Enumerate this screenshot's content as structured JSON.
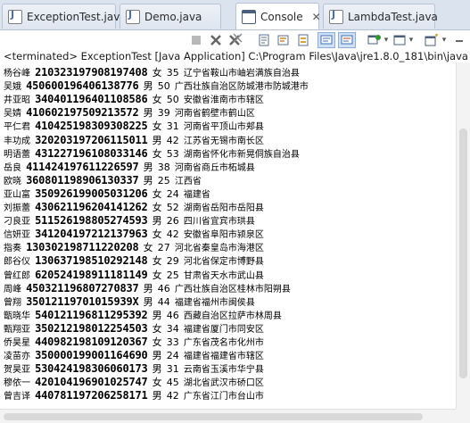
{
  "tabs": [
    {
      "label": "ExceptionTest.java",
      "icon": "java-file-icon",
      "active": false
    },
    {
      "label": "Demo.java",
      "icon": "java-file-icon",
      "active": false
    },
    {
      "label": "Console",
      "icon": "console-icon",
      "active": true,
      "close": "✕"
    },
    {
      "label": "LambdaTest.java",
      "icon": "java-file-icon",
      "active": false
    }
  ],
  "toolbar": {
    "icons": [
      "terminate-icon",
      "remove-launch-icon",
      "remove-all-terminated-icon",
      "scroll-lock-icon",
      "word-wrap-icon",
      "show-console-output-icon",
      "show-error-output-icon",
      "pin-console-icon",
      "display-selected-console-icon",
      "open-console-icon"
    ]
  },
  "status": {
    "text": "<terminated> ExceptionTest [Java Application] C:\\Program Files\\Java\\jre1.8.0_181\\bin\\javaw.exe"
  },
  "console": {
    "lines": [
      {
        "name": "杨谷峰",
        "id": "210323197908197408",
        "sex": "女",
        "age": "35",
        "place": "辽宁省鞍山市岫岩满族自治县"
      },
      {
        "name": "吴娥",
        "id": "450600196406138776",
        "sex": "男",
        "age": "50",
        "place": "广西壮族自治区防城港市防城港市"
      },
      {
        "name": "井亚昭",
        "id": "340401196401108586",
        "sex": "女",
        "age": "50",
        "place": "安徽省淮南市市辖区"
      },
      {
        "name": "吴婧",
        "id": "410602197509213572",
        "sex": "男",
        "age": "39",
        "place": "河南省鹤壁市鹤山区"
      },
      {
        "name": "平仁君",
        "id": "410425198309308225",
        "sex": "女",
        "age": "31",
        "place": "河南省平顶山市郏县"
      },
      {
        "name": "丰功成",
        "id": "320203197206115011",
        "sex": "男",
        "age": "42",
        "place": "江苏省无锡市南长区"
      },
      {
        "name": "明语蕾",
        "id": "431227196108033146",
        "sex": "女",
        "age": "53",
        "place": "湖南省怀化市新晃侗族自治县"
      },
      {
        "name": "岳良",
        "id": "411424197611226597",
        "sex": "男",
        "age": "38",
        "place": "河南省商丘市柘城县"
      },
      {
        "name": "欧晓",
        "id": "360801198906130337",
        "sex": "男",
        "age": "25",
        "place": "江西省"
      },
      {
        "name": "亚山富",
        "id": "350926199005031206",
        "sex": "女",
        "age": "24",
        "place": "福建省"
      },
      {
        "name": "刘振蕾",
        "id": "430621196204141262",
        "sex": "女",
        "age": "52",
        "place": "湖南省岳阳市岳阳县"
      },
      {
        "name": "刁良亚",
        "id": "511526198805274593",
        "sex": "男",
        "age": "26",
        "place": "四川省宜宾市珙县"
      },
      {
        "name": "信妍亚",
        "id": "341204197212137963",
        "sex": "女",
        "age": "42",
        "place": "安徽省阜阳市颍泉区"
      },
      {
        "name": "指奏",
        "id": "130302198711220208",
        "sex": "女",
        "age": "27",
        "place": "河北省秦皇岛市海港区"
      },
      {
        "name": "郎谷仪",
        "id": "130637198510292148",
        "sex": "女",
        "age": "29",
        "place": "河北省保定市博野县"
      },
      {
        "name": "曾红郎",
        "id": "620524198911181149",
        "sex": "女",
        "age": "25",
        "place": "甘肃省天水市武山县"
      },
      {
        "name": "周峰",
        "id": "450321196807270837",
        "sex": "男",
        "age": "46",
        "place": "广西壮族自治区桂林市阳朔县"
      },
      {
        "name": "曾翔",
        "id": "35012119701015939X",
        "sex": "男",
        "age": "44",
        "place": "福建省福州市闽侯县"
      },
      {
        "name": "甑晓华",
        "id": "540121196811295392",
        "sex": "男",
        "age": "46",
        "place": "西藏自治区拉萨市林周县"
      },
      {
        "name": "甄翔亚",
        "id": "350212198012254503",
        "sex": "女",
        "age": "34",
        "place": "福建省厦门市同安区"
      },
      {
        "name": "侨昊星",
        "id": "440982198109120367",
        "sex": "女",
        "age": "33",
        "place": "广东省茂名市化州市"
      },
      {
        "name": "凌苗亦",
        "id": "350000199001164690",
        "sex": "男",
        "age": "24",
        "place": "福建省福建省市辖区"
      },
      {
        "name": "贺昊亚",
        "id": "530424198306060173",
        "sex": "男",
        "age": "31",
        "place": "云南省玉溪市华宁县"
      },
      {
        "name": "穆依一",
        "id": "420104196901025747",
        "sex": "女",
        "age": "45",
        "place": "湖北省武汉市硚口区"
      },
      {
        "name": "曾吉译",
        "id": "440781197206258171",
        "sex": "男",
        "age": "42",
        "place": "广东省江门市台山市"
      }
    ]
  }
}
